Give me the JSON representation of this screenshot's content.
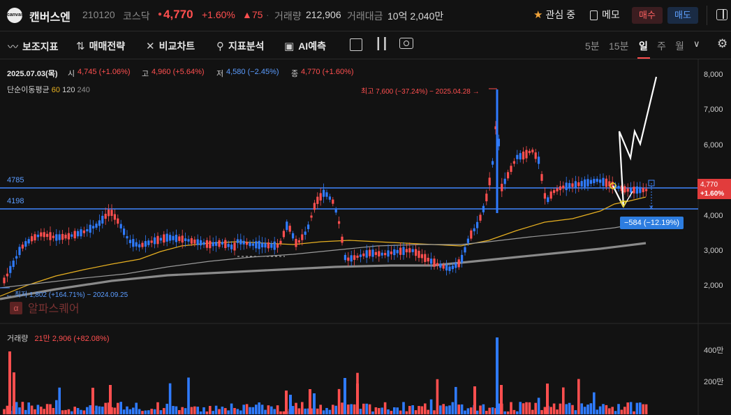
{
  "header": {
    "name": "캔버스엔",
    "code": "210120",
    "market": "코스닥",
    "price": "4,770",
    "change_pct": "+1.60%",
    "change": "▲75",
    "volume_label": "거래량",
    "volume": "212,906",
    "amount_label": "거래대금",
    "amount": "10억 2,040만",
    "watch_label": "관심 중",
    "memo_label": "메모",
    "buy_label": "매수",
    "sell_label": "매도"
  },
  "toolbar": {
    "items": [
      "보조지표",
      "매매전략",
      "비교차트",
      "지표분석",
      "AI예측"
    ],
    "periods": [
      "5분",
      "15분",
      "일",
      "주",
      "월"
    ],
    "active_period": "일"
  },
  "info": {
    "date": "2025.07.03(목)",
    "open_label": "시",
    "open": "4,745 (+1.06%)",
    "high_label": "고",
    "high": "4,960 (+5.64%)",
    "low_label": "저",
    "low": "4,580 (−2.45%)",
    "close_label": "종",
    "close": "4,770 (+1.60%)"
  },
  "ma": {
    "label": "단순이동평균",
    "p60": "60",
    "p120": "120",
    "p240": "240"
  },
  "levels": {
    "upper": "4785",
    "lower": "4198"
  },
  "annotations": {
    "high": "최고 7,600 (−37.24%) − 2025.04.28 →",
    "low": "← 최저 1,802 (+164.71%) − 2024.09.25",
    "diff": "−584 (−12.19%)"
  },
  "price_axis": [
    "8,000",
    "7,000",
    "6,000",
    "4,000",
    "3,000",
    "2,000"
  ],
  "price_tag": {
    "price": "4,770",
    "pct": "+1.60%"
  },
  "watermark": "알파스퀘어",
  "volume_panel": {
    "label": "거래량",
    "value": "21만 2,906 (+82.08%)",
    "axis": [
      "400만",
      "200만"
    ]
  },
  "colors": {
    "up": "#ff4f4f",
    "down": "#2f7bff",
    "level": "#3f86ff",
    "ma60": "#e7b021",
    "ma120": "#9a9a9a",
    "ma240": "#8a8a8a"
  }
}
